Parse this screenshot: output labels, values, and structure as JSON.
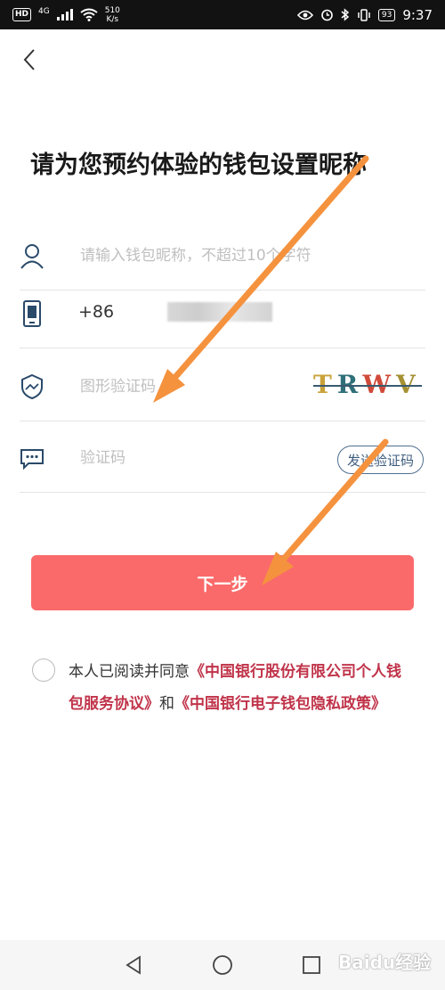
{
  "status_bar": {
    "hd_badge": "HD",
    "network": "4G",
    "speed_value": "510",
    "speed_unit": "K/s",
    "battery": "93",
    "time": "9:37"
  },
  "page": {
    "title": "请为您预约体验的钱包设置昵称"
  },
  "form": {
    "nickname_placeholder": "请输入钱包昵称，不超过10个字符",
    "phone_prefix": "+86",
    "captcha_placeholder": "图形验证码",
    "captcha_letters": [
      "T",
      "R",
      "W",
      "V"
    ],
    "captcha_colors": [
      "#c9a23a",
      "#2f6f7a",
      "#d04a3a",
      "#a59032"
    ],
    "sms_placeholder": "验证码",
    "send_code_label": "发送验证码"
  },
  "next_button": {
    "label": "下一步",
    "color": "#fa6a6a"
  },
  "agreement": {
    "prefix": "本人已阅读并同意",
    "link1": "《中国银行股份有限公司个人钱包服务协议》",
    "joiner": "和",
    "link2": "《中国银行电子钱包隐私政策》",
    "link_color": "#c0344a"
  },
  "watermark": {
    "text": "Baidu经验"
  },
  "annotation": {
    "arrow_color": "#f5923e"
  }
}
